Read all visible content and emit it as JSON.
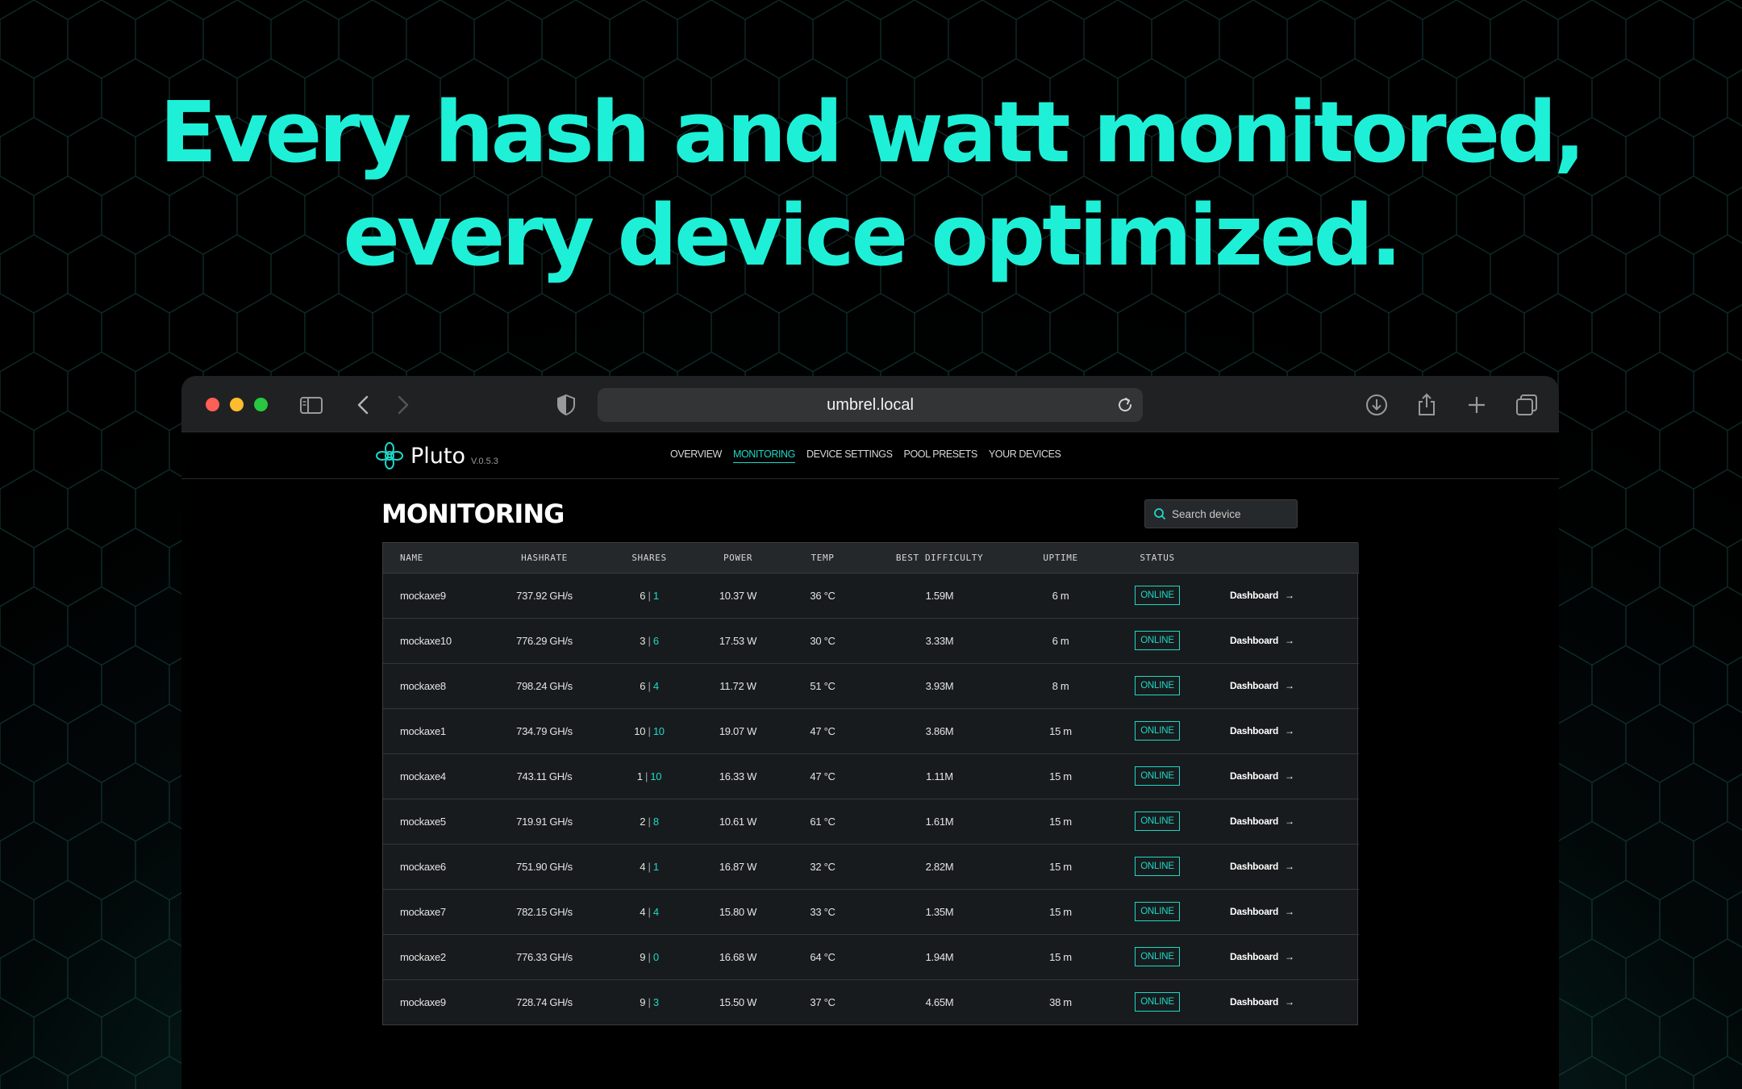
{
  "headline": {
    "line1": "Every hash and watt monitored,",
    "line2": "every device optimized."
  },
  "browser": {
    "url": "umbrel.local"
  },
  "app": {
    "brand": "Pluto",
    "version": "V.0.5.3",
    "nav": [
      {
        "label": "OVERVIEW",
        "active": false
      },
      {
        "label": "MONITORING",
        "active": true
      },
      {
        "label": "DEVICE SETTINGS",
        "active": false
      },
      {
        "label": "POOL PRESETS",
        "active": false
      },
      {
        "label": "YOUR DEVICES",
        "active": false
      }
    ],
    "page_title": "MONITORING",
    "search_placeholder": "Search device"
  },
  "table": {
    "columns": [
      "NAME",
      "HASHRATE",
      "SHARES",
      "POWER",
      "TEMP",
      "BEST DIFFICULTY",
      "UPTIME",
      "STATUS"
    ],
    "action_label": "Dashboard",
    "rows": [
      {
        "name": "mockaxe9",
        "hashrate": "737.92 GH/s",
        "shares_a": "6",
        "shares_b": "1",
        "power": "10.37 W",
        "temp": "36 °C",
        "best": "1.59M",
        "uptime": "6 m",
        "status": "ONLINE"
      },
      {
        "name": "mockaxe10",
        "hashrate": "776.29 GH/s",
        "shares_a": "3",
        "shares_b": "6",
        "power": "17.53 W",
        "temp": "30 °C",
        "best": "3.33M",
        "uptime": "6 m",
        "status": "ONLINE"
      },
      {
        "name": "mockaxe8",
        "hashrate": "798.24 GH/s",
        "shares_a": "6",
        "shares_b": "4",
        "power": "11.72 W",
        "temp": "51 °C",
        "best": "3.93M",
        "uptime": "8 m",
        "status": "ONLINE"
      },
      {
        "name": "mockaxe1",
        "hashrate": "734.79 GH/s",
        "shares_a": "10",
        "shares_b": "10",
        "power": "19.07 W",
        "temp": "47 °C",
        "best": "3.86M",
        "uptime": "15 m",
        "status": "ONLINE"
      },
      {
        "name": "mockaxe4",
        "hashrate": "743.11 GH/s",
        "shares_a": "1",
        "shares_b": "10",
        "power": "16.33 W",
        "temp": "47 °C",
        "best": "1.11M",
        "uptime": "15 m",
        "status": "ONLINE"
      },
      {
        "name": "mockaxe5",
        "hashrate": "719.91 GH/s",
        "shares_a": "2",
        "shares_b": "8",
        "power": "10.61 W",
        "temp": "61 °C",
        "best": "1.61M",
        "uptime": "15 m",
        "status": "ONLINE"
      },
      {
        "name": "mockaxe6",
        "hashrate": "751.90 GH/s",
        "shares_a": "4",
        "shares_b": "1",
        "power": "16.87 W",
        "temp": "32 °C",
        "best": "2.82M",
        "uptime": "15 m",
        "status": "ONLINE"
      },
      {
        "name": "mockaxe7",
        "hashrate": "782.15 GH/s",
        "shares_a": "4",
        "shares_b": "4",
        "power": "15.80 W",
        "temp": "33 °C",
        "best": "1.35M",
        "uptime": "15 m",
        "status": "ONLINE"
      },
      {
        "name": "mockaxe2",
        "hashrate": "776.33 GH/s",
        "shares_a": "9",
        "shares_b": "0",
        "power": "16.68 W",
        "temp": "64 °C",
        "best": "1.94M",
        "uptime": "15 m",
        "status": "ONLINE"
      },
      {
        "name": "mockaxe9",
        "hashrate": "728.74 GH/s",
        "shares_a": "9",
        "shares_b": "3",
        "power": "15.50 W",
        "temp": "37 °C",
        "best": "4.65M",
        "uptime": "38 m",
        "status": "ONLINE"
      }
    ]
  },
  "colors": {
    "accent": "#1ef0d8",
    "background": "#000000",
    "table_bg": "#181b1d"
  }
}
